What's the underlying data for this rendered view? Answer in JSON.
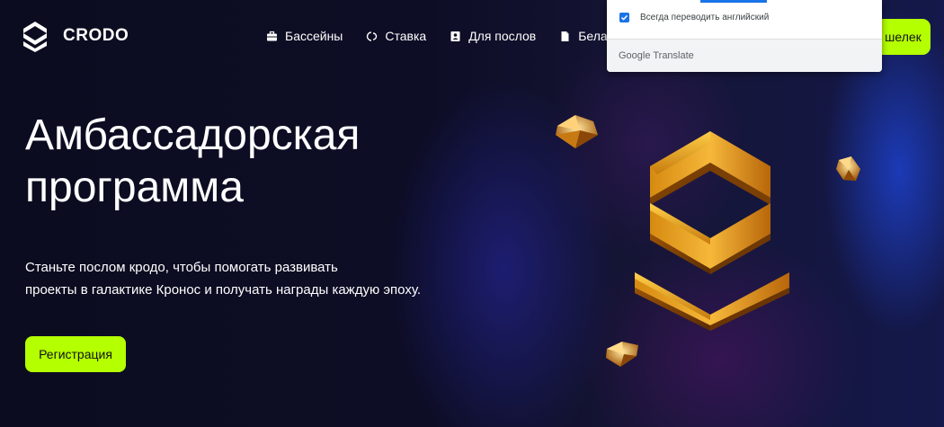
{
  "brand": {
    "name": "CRODO",
    "logo_icon": "crodo-logo-icon"
  },
  "nav": {
    "items": [
      {
        "label": "Бассейны",
        "icon": "briefcase-icon"
      },
      {
        "label": "Ставка",
        "icon": "stake-icon"
      },
      {
        "label": "Для послов",
        "icon": "ambassador-icon"
      },
      {
        "label": "Белая",
        "icon": "document-icon"
      }
    ],
    "wallet_label": "шелек"
  },
  "hero": {
    "title_line1": "Амбассадорская",
    "title_line2": "программа",
    "desc_line1": "Станьте послом кродо, чтобы помогать развивать",
    "desc_line2": "проекты в галактике Кронос и получать награды каждую эпоху.",
    "register_label": "Регистрация"
  },
  "translate_popup": {
    "checkbox_label": "Всегда переводить английский",
    "checkbox_checked": true,
    "brand_google": "Google",
    "brand_translate": "Translate"
  },
  "colors": {
    "accent": "#b4ff00",
    "background": "#0b0c22",
    "google_blue": "#1a73e8"
  }
}
